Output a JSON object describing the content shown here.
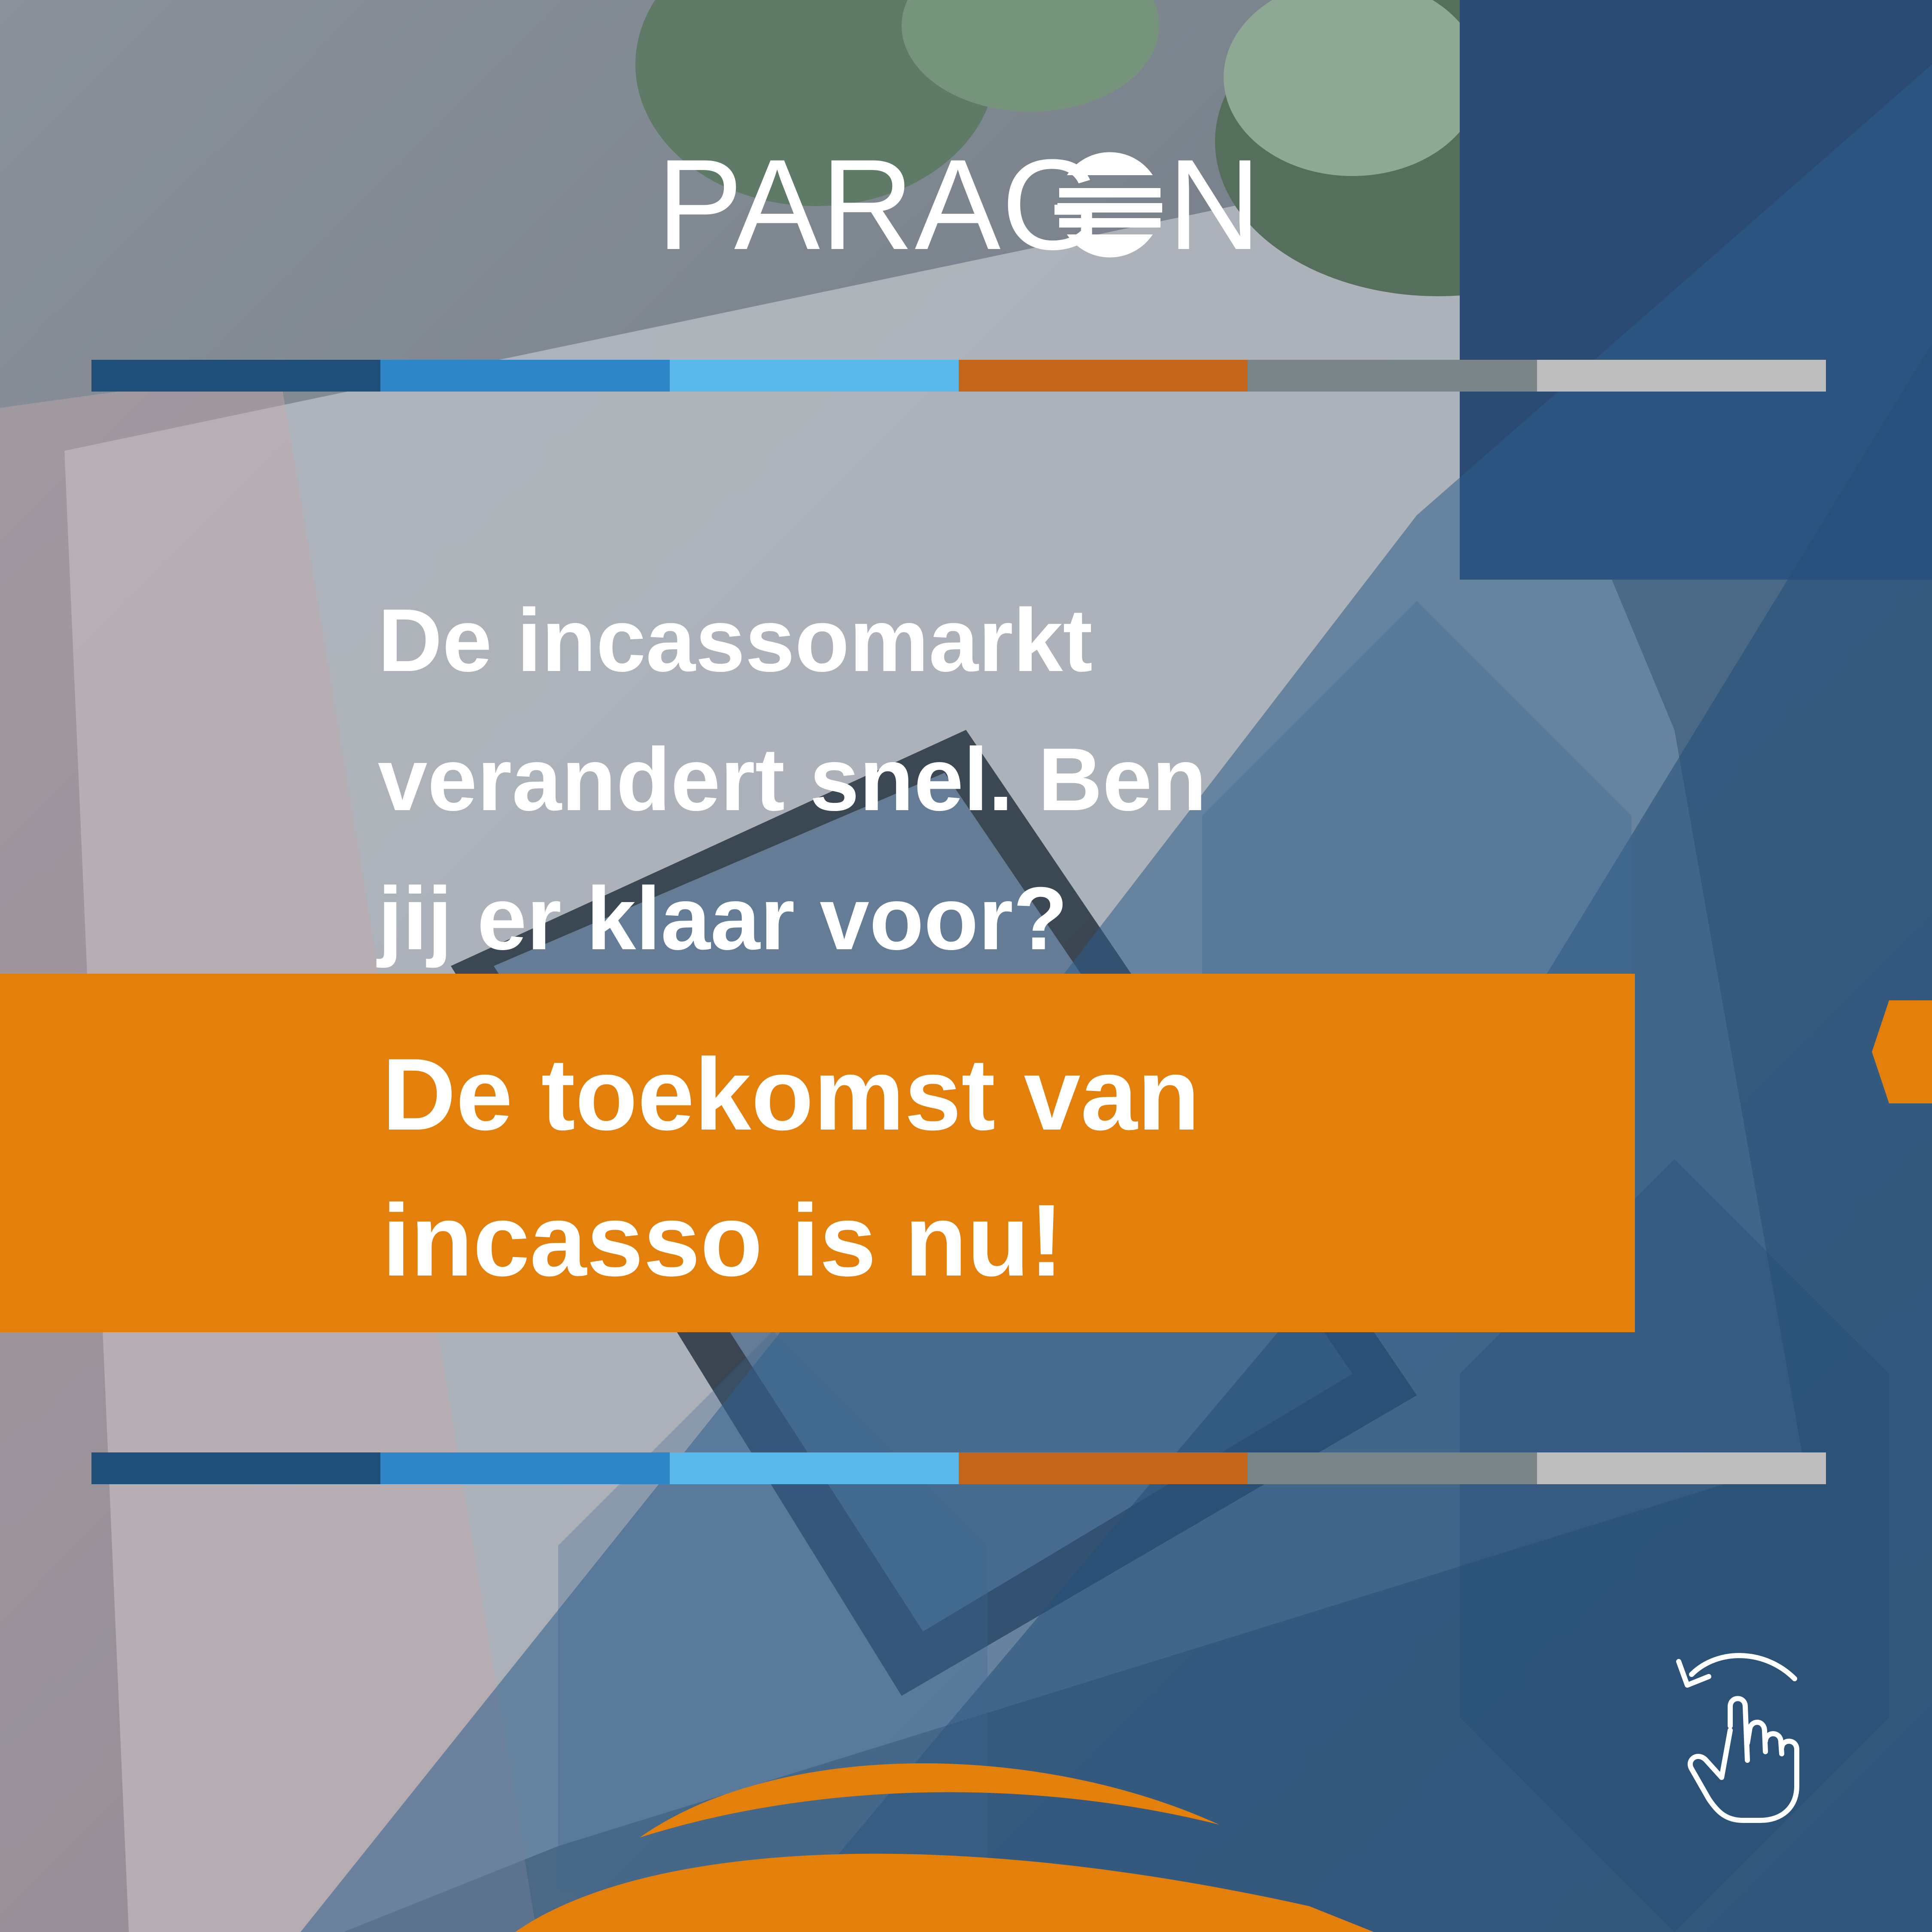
{
  "brand": {
    "logo_text": "PARAGON",
    "colors": {
      "orange": "#E37F0B",
      "navy": "#1F4E79",
      "blue": "#2E86C9",
      "light_blue": "#5BB8EA",
      "rust": "#C4661B",
      "grey": "#7A8588",
      "light_grey": "#BDBDBD"
    }
  },
  "background": {
    "description_icons": [
      "photo-background",
      "hexagon-pattern"
    ]
  },
  "headline": {
    "line1": "De incassomarkt",
    "line2": "verandert snel. Ben",
    "line3": "jij er klaar voor?"
  },
  "banner": {
    "line1": "De toekomst van",
    "line2": "incasso is nu!"
  },
  "stripe_colors": [
    "#1F4E79",
    "#2E86C9",
    "#5BB8EA",
    "#C4661B",
    "#7A8588",
    "#BDBDBD"
  ],
  "swipe_hint": {
    "icon": "swipe-hand-icon"
  }
}
